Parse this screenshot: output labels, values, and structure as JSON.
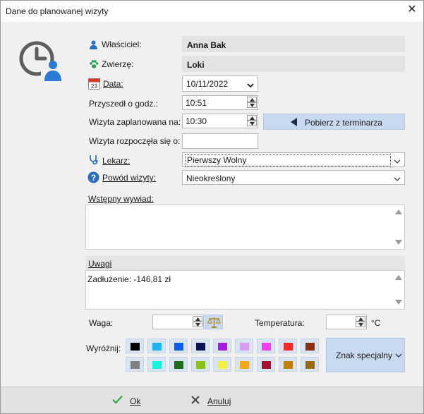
{
  "window": {
    "title": "Dane do planowanej wizyty"
  },
  "owner": {
    "label": "Właściciel:",
    "value": "Anna Bak"
  },
  "animal": {
    "label": "Zwierzę:",
    "value": "Loki"
  },
  "date": {
    "label": "Data:",
    "value": "10/11/2022"
  },
  "arrived": {
    "label": "Przyszedł o godz.:",
    "value": "10:51"
  },
  "planned": {
    "label": "Wizyta zaplanowana na:",
    "value": "10:30"
  },
  "fetch_button": {
    "label": "Pobierz z terminarza"
  },
  "started": {
    "label": "Wizyta rozpoczęła się o:",
    "value": ""
  },
  "doctor": {
    "label": "Lekarz:",
    "value": "Pierwszy Wolny"
  },
  "reason": {
    "label": "Powód wizyty:",
    "value": "Nieokreślony"
  },
  "interview": {
    "label": "Wstępny wywiad:",
    "value": ""
  },
  "notes": {
    "label": "Uwagi",
    "value": "Zadłużenie: -146,81 zł"
  },
  "weight": {
    "label": "Waga:",
    "value": ""
  },
  "temperature": {
    "label": "Temperatura:",
    "value": "",
    "unit": "°C"
  },
  "highlight": {
    "label": "Wyróżnij:",
    "colors_row1": [
      "#000000",
      "#1fb4f0",
      "#0b5cf2",
      "#0a1450",
      "#a81ae8",
      "#d99af2",
      "#f23ef2",
      "#f22a2a",
      "#8a2e0e"
    ],
    "colors_row2": [
      "#808080",
      "#19f2dc",
      "#1d6e15",
      "#8ac21a",
      "#f2f23a",
      "#f2a81a",
      "#a8102e",
      "#c08010",
      "#9a6a0e"
    ]
  },
  "special_char_button": {
    "label": "Znak specjalny"
  },
  "footer": {
    "ok_label": "Ok",
    "cancel_label": "Anuluj"
  }
}
